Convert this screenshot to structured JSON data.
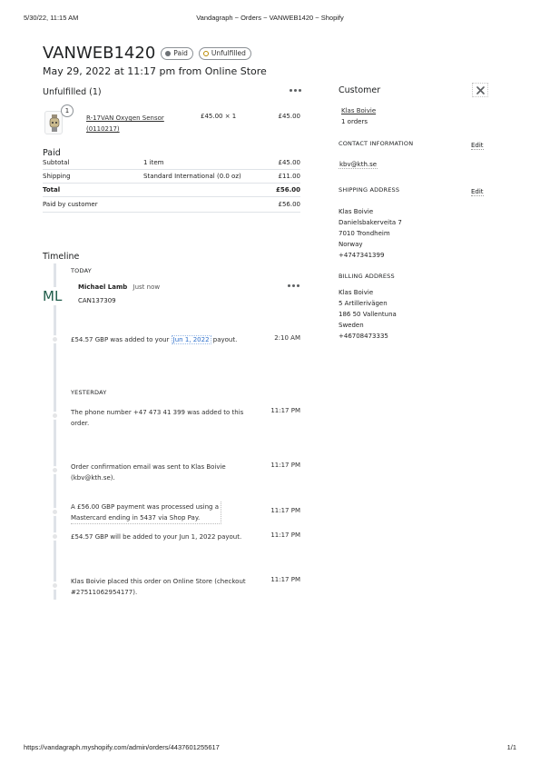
{
  "print_header": {
    "datetime": "5/30/22, 11:15 AM",
    "title": "Vandagraph ~ Orders ~ VANWEB1420 ~ Shopify"
  },
  "print_footer": {
    "url": "https://vandagraph.myshopify.com/admin/orders/4437601255617",
    "page": "1/1"
  },
  "order": {
    "number": "VANWEB1420",
    "badges": {
      "paid": "Paid",
      "unfulfilled": "Unfulfilled"
    },
    "subtitle": "May 29, 2022 at 11:17 pm from Online Store"
  },
  "unfulfilled": {
    "title": "Unfulfilled (1)",
    "more_icon": "more-horizontal-icon",
    "item": {
      "qty_badge": "1",
      "name_line1": "R-17VAN Oxygen Sensor",
      "name_line2": "(0110217)",
      "price_qty": "£45.00 × 1",
      "total": "£45.00"
    }
  },
  "paid": {
    "title": "Paid",
    "rows": [
      {
        "label": "Subtotal",
        "detail": "1 item",
        "amount": "£45.00"
      },
      {
        "label": "Shipping",
        "detail": "Standard International (0.0 oz)",
        "amount": "£11.00"
      },
      {
        "label": "Total",
        "detail": "",
        "amount": "£56.00"
      }
    ],
    "paid_by": {
      "label": "Paid by customer",
      "amount": "£56.00"
    }
  },
  "timeline": {
    "title": "Timeline",
    "today_label": "TODAY",
    "avatar_initials": "ML",
    "comment": {
      "author": "Michael Lamb",
      "time": "Just now",
      "text": "CAN137309"
    },
    "events_today": [
      {
        "pre": "£54.57 GBP was added to your ",
        "link": "Jun 1, 2022",
        "post": " payout.",
        "time": "2:10 AM"
      }
    ],
    "yesterday_label": "YESTERDAY",
    "events_yesterday": [
      {
        "line1": "The phone number +47 473 41 399 was added to this",
        "line2": "order.",
        "time": "11:17 PM"
      },
      {
        "line1": "Order confirmation email was sent to Klas Boivie",
        "line2": "(kbv@kth.se).",
        "time": "11:17 PM"
      },
      {
        "line1": "A £56.00 GBP payment was processed using a",
        "line2": "Mastercard ending in 5437 via Shop Pay.",
        "time": "11:17 PM"
      },
      {
        "line1": "£54.57 GBP will be added to your Jun 1, 2022 payout.",
        "line2": "",
        "time": "11:17 PM"
      },
      {
        "line1": "Klas Boivie placed this order on Online Store (checkout",
        "line2": "#27511062954177).",
        "time": "11:17 PM"
      }
    ]
  },
  "customer": {
    "title": "Customer",
    "close_icon": "close-icon",
    "name": "Klas Boivie",
    "orders": "1 orders",
    "contact_title": "CONTACT INFORMATION",
    "edit_label": "Edit",
    "email": "kbv@kth.se",
    "shipping_title": "SHIPPING ADDRESS",
    "shipping_lines": [
      "Klas Boivie",
      "Danielsbakerveita 7",
      "7010 Trondheim",
      "Norway",
      "+4747341399"
    ],
    "billing_title": "BILLING ADDRESS",
    "billing_lines": [
      "Klas Boivie",
      "5 Artillerivägen",
      "186 50 Vallentuna",
      "Sweden",
      "+46708473335"
    ]
  },
  "colors": {
    "paid_dot": "#6d7175",
    "unfulfilled_dot": "#b98900",
    "link": "#2c6ecb"
  }
}
